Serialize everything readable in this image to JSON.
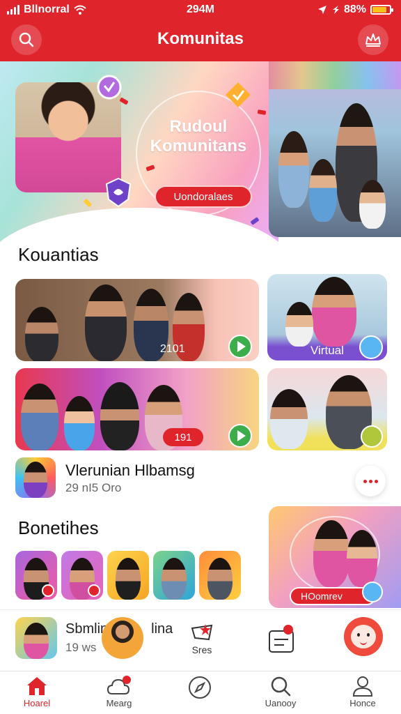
{
  "status_bar": {
    "carrier": "Bllnorral",
    "time": "294M",
    "battery": "88%"
  },
  "header": {
    "title": "Komunitas"
  },
  "hero": {
    "heading_line1": "Rudoul",
    "heading_line2": "Komunitans",
    "cta_label": "Uondoralaes"
  },
  "section1": {
    "title": "Kouantias",
    "tiles": [
      {
        "badge": "2101"
      },
      {
        "badge": "Virtual"
      },
      {
        "badge": "191"
      },
      {
        "badge": ""
      }
    ]
  },
  "list_row": {
    "title": "Vlerunian Hlbamsg",
    "subtitle": "29 nI5 Oro"
  },
  "section2": {
    "title": "Bonetihes",
    "promo_cta": "HOomrev"
  },
  "mini_player": {
    "title": "Sbmlin",
    "title_suffix": "lina",
    "subtitle": "19 ws",
    "center_label": "Sres"
  },
  "tabbar": {
    "tabs": [
      {
        "label": "Hoarel"
      },
      {
        "label": "Mearg"
      },
      {
        "label": ""
      },
      {
        "label": "Uanooy"
      },
      {
        "label": "Honce"
      }
    ]
  },
  "colors": {
    "brand": "#e0242c",
    "accent_green": "#3bae4b"
  }
}
